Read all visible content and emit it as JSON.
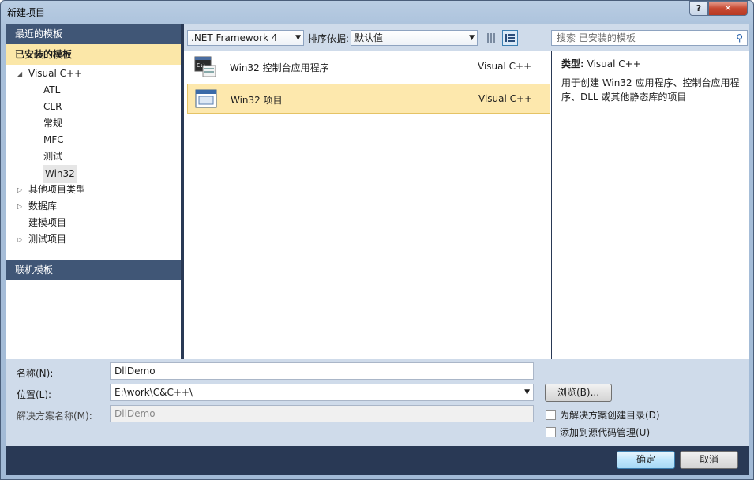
{
  "window": {
    "title": "新建项目",
    "help": "?",
    "close": "✕"
  },
  "left": {
    "recent": "最近的模板",
    "installed": "已安装的模板",
    "tree": [
      {
        "label": "Visual C++",
        "arrow": "◢",
        "level": 0
      },
      {
        "label": "ATL",
        "arrow": "",
        "level": 1
      },
      {
        "label": "CLR",
        "arrow": "",
        "level": 1
      },
      {
        "label": "常规",
        "arrow": "",
        "level": 1
      },
      {
        "label": "MFC",
        "arrow": "",
        "level": 1
      },
      {
        "label": "测试",
        "arrow": "",
        "level": 1
      },
      {
        "label": "Win32",
        "arrow": "",
        "level": 1,
        "selected": true
      },
      {
        "label": "其他项目类型",
        "arrow": "▷",
        "level": 0
      },
      {
        "label": "数据库",
        "arrow": "▷",
        "level": 0
      },
      {
        "label": "建模项目",
        "arrow": "",
        "level": 0
      },
      {
        "label": "测试项目",
        "arrow": "▷",
        "level": 0
      }
    ],
    "online": "联机模板"
  },
  "toolbar": {
    "framework": ".NET Framework 4",
    "sort_label": "排序依据:",
    "sort_value": "默认值",
    "search_placeholder": "搜索 已安装的模板"
  },
  "templates": [
    {
      "name": "Win32 控制台应用程序",
      "lang": "Visual C++",
      "selected": false
    },
    {
      "name": "Win32 项目",
      "lang": "Visual C++",
      "selected": true
    }
  ],
  "details": {
    "type_label": "类型:",
    "type_value": "Visual C++",
    "description": "用于创建 Win32 应用程序、控制台应用程序、DLL 或其他静态库的项目"
  },
  "form": {
    "name_label": "名称(N):",
    "name_value": "DllDemo",
    "location_label": "位置(L):",
    "location_value": "E:\\work\\C&C++\\",
    "solution_label": "解决方案名称(M):",
    "solution_value": "DllDemo",
    "browse": "浏览(B)...",
    "create_dir": "为解决方案创建目录(D)",
    "add_source": "添加到源代码管理(U)"
  },
  "buttons": {
    "ok": "确定",
    "cancel": "取消"
  }
}
